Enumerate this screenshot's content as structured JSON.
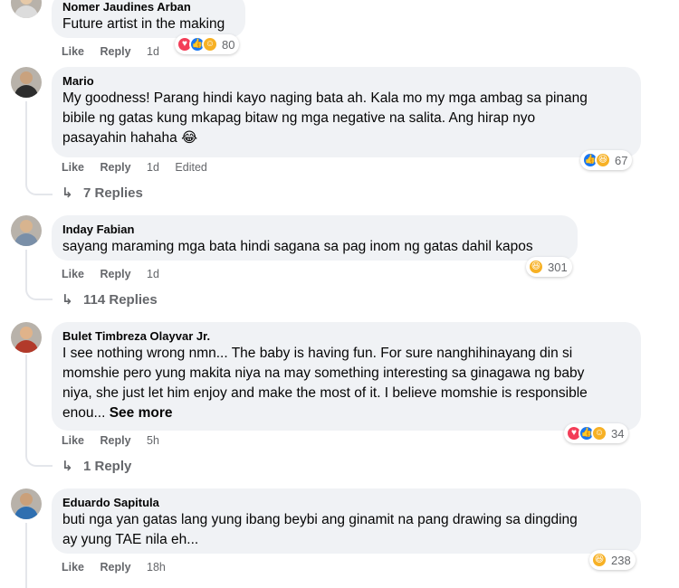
{
  "comments": [
    {
      "author": "Nomer Jaudines Arban",
      "text": "Future artist in the making",
      "like": "Like",
      "reply": "Reply",
      "time": "1d",
      "reaction_count": "80"
    },
    {
      "author": "Mario",
      "line1": "My goodness! Parang hindi kayo naging bata ah. Kala mo my mga ambag sa pinang",
      "line2": "bibile ng gatas kung mkapag bitaw ng mga negative na salita. Ang hirap nyo",
      "line3": "pasayahin hahaha 😂",
      "like": "Like",
      "reply": "Reply",
      "time": "1d",
      "edited": "Edited",
      "reaction_count": "67",
      "replies": "7 Replies"
    },
    {
      "author": "Inday Fabian",
      "text": "sayang maraming mga bata hindi sagana sa pag inom ng gatas dahil kapos",
      "like": "Like",
      "reply": "Reply",
      "time": "1d",
      "reaction_count": "301",
      "replies": "114 Replies"
    },
    {
      "author": "Bulet Timbreza Olayvar Jr.",
      "line1": "I see nothing wrong nmn... The baby is having fun. For sure nanghihinayang din si",
      "line2": "momshie pero yung makita niya na may something interesting sa ginagawa ng baby",
      "line3": "niya, she just let him enjoy and make the most of it. I believe momshie is responsible",
      "line4": "enou...",
      "see_more": "See more",
      "like": "Like",
      "reply": "Reply",
      "time": "5h",
      "reaction_count": "34",
      "replies": "1 Reply"
    },
    {
      "author": "Eduardo Sapitula",
      "line1": "buti nga yan gatas lang yung ibang beybi ang ginamit na pang drawing sa dingding",
      "line2": "ay yung TAE nila eh...",
      "like": "Like",
      "reply": "Reply",
      "time": "18h",
      "reaction_count": "238"
    }
  ],
  "reaction_icons": {
    "love": "love-reaction",
    "like": "like-reaction",
    "haha": "haha-reaction",
    "care": "care-reaction"
  },
  "colors": {
    "bubble": "#f0f2f5",
    "meta": "#65676b",
    "like_blue": "#1877f2",
    "love_red": "#f33e58",
    "haha_yellow": "#f7b125"
  }
}
